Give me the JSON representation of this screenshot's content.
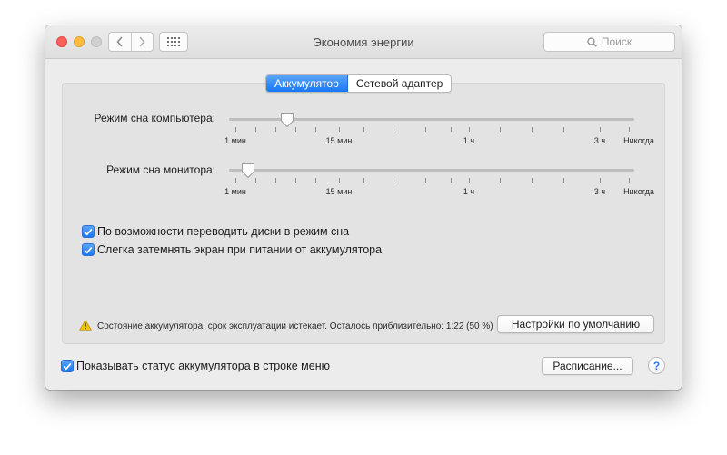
{
  "window": {
    "title": "Экономия энергии"
  },
  "search": {
    "placeholder": "Поиск"
  },
  "tabs": [
    {
      "label": "Аккумулятор",
      "active": true
    },
    {
      "label": "Сетевой адаптер",
      "active": false
    }
  ],
  "sliders": [
    {
      "label": "Режим сна компьютера:",
      "value_label": "≈ 10 мин"
    },
    {
      "label": "Режим сна монитора:",
      "value_label": "≈ 2 мин"
    }
  ],
  "tick_labels": [
    "1 мин",
    "15 мин",
    "1 ч",
    "3 ч",
    "Никогда"
  ],
  "checkboxes": [
    {
      "label": "По возможности переводить диски в режим сна",
      "checked": true
    },
    {
      "label": "Слегка затемнять экран при питании от аккумулятора",
      "checked": true
    }
  ],
  "battery_status": "Состояние аккумулятора: срок эксплуатации истекает. Осталось приблизительно: 1:22 (50 %)",
  "buttons": {
    "defaults": "Настройки по умолчанию",
    "schedule": "Расписание...",
    "help": "?"
  },
  "footer_checkbox": {
    "label": "Показывать статус аккумулятора в строке меню",
    "checked": true
  },
  "colors": {
    "accent": "#1677f5",
    "close": "#fc605c",
    "minimize": "#fdbc40",
    "zoom_disabled": "#d0d0d0",
    "warning": "#f2c500"
  }
}
